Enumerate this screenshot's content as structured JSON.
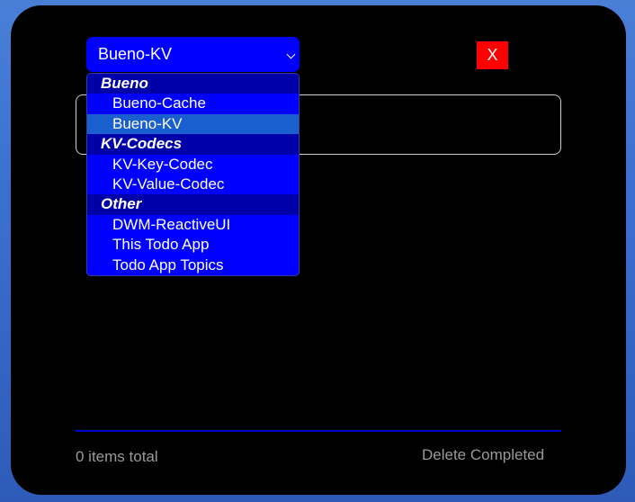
{
  "selector": {
    "value": "Bueno-KV",
    "groups": [
      {
        "label": "Bueno",
        "options": [
          "Bueno-Cache",
          "Bueno-KV"
        ]
      },
      {
        "label": "KV-Codecs",
        "options": [
          "KV-Key-Codec",
          "KV-Value-Codec"
        ]
      },
      {
        "label": "Other",
        "options": [
          "DWM-ReactiveUI",
          "This Todo App",
          "Todo App Topics"
        ]
      }
    ],
    "highlighted": "Bueno-KV"
  },
  "close_button": {
    "label": "X"
  },
  "new_todo": {
    "value": "",
    "placeholder": ""
  },
  "footer": {
    "items_total": "0 items total",
    "delete_completed": "Delete Completed"
  },
  "colors": {
    "select_bg": "#0000ff",
    "group_bg": "#0000a8",
    "highlight_bg": "#1a5fd0",
    "close_bg": "#ff0000",
    "divider": "#0000cc"
  }
}
